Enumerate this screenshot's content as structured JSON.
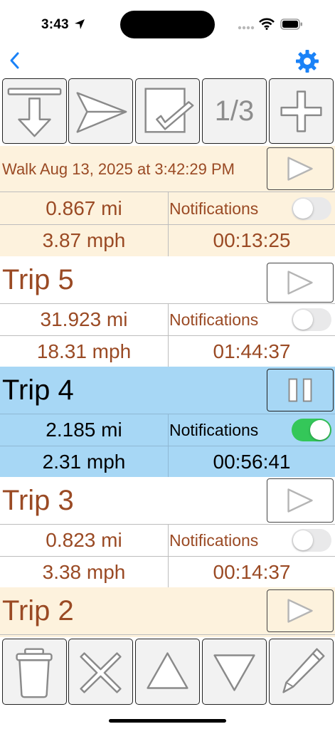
{
  "status_bar": {
    "time": "3:43"
  },
  "toolbar": {
    "page_indicator": "1/3"
  },
  "colors": {
    "accent": "#1a82f7",
    "brown_text": "#9a4a24",
    "cream_bg": "#fdf2dd",
    "active_bg": "#a7d7f5",
    "switch_on": "#34c759",
    "switch_off": "#e9e9ea"
  },
  "trips": [
    {
      "name": "Walk Aug 13, 2025 at 3:42:29 PM",
      "distance": "0.867 mi",
      "speed": "3.87 mph",
      "notifications_label": "Notifications",
      "notifications_on": false,
      "duration": "00:13:25",
      "state": "stopped"
    },
    {
      "name": "Trip 5",
      "distance": "31.923 mi",
      "speed": "18.31 mph",
      "notifications_label": "Notifications",
      "notifications_on": false,
      "duration": "01:44:37",
      "state": "stopped"
    },
    {
      "name": "Trip 4",
      "distance": "2.185 mi",
      "speed": "2.31 mph",
      "notifications_label": "Notifications",
      "notifications_on": true,
      "duration": "00:56:41",
      "state": "running"
    },
    {
      "name": "Trip 3",
      "distance": "0.823 mi",
      "speed": "3.38 mph",
      "notifications_label": "Notifications",
      "notifications_on": false,
      "duration": "00:14:37",
      "state": "stopped"
    },
    {
      "name": "Trip 2",
      "state": "stopped"
    }
  ]
}
